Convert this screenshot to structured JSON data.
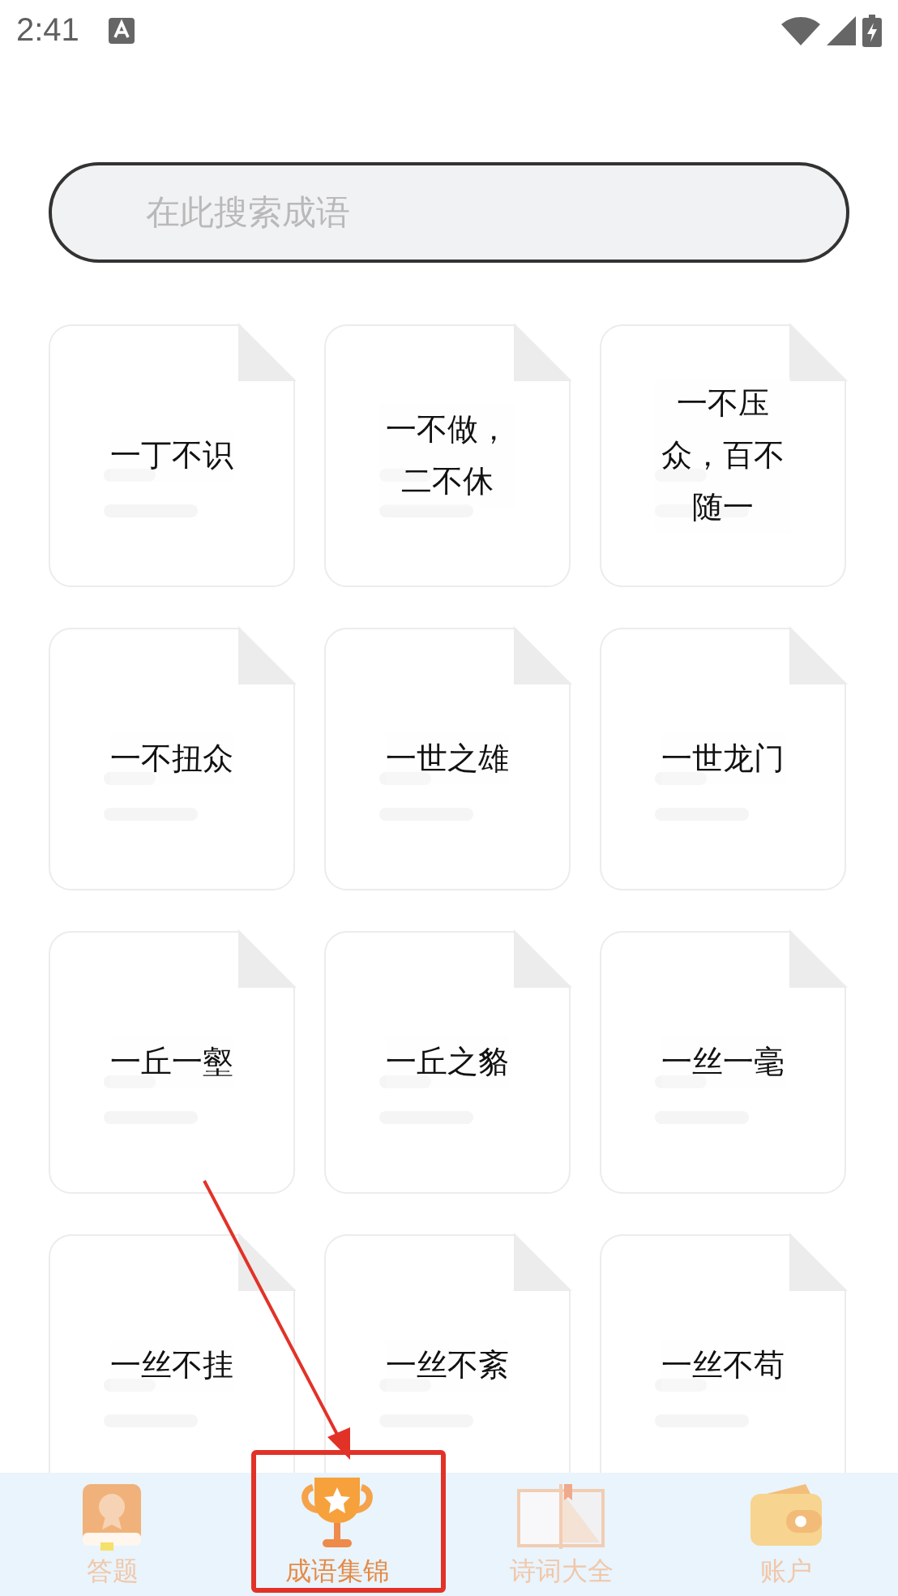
{
  "status_bar": {
    "time": "2:41"
  },
  "search": {
    "placeholder": "在此搜索成语"
  },
  "idioms": [
    {
      "text": "一丁不识"
    },
    {
      "text": "一不做，二不休"
    },
    {
      "text": "一不压众，百不随一"
    },
    {
      "text": "一不扭众"
    },
    {
      "text": "一世之雄"
    },
    {
      "text": "一世龙门"
    },
    {
      "text": "一丘一壑"
    },
    {
      "text": "一丘之貉"
    },
    {
      "text": "一丝一毫"
    },
    {
      "text": "一丝不挂"
    },
    {
      "text": "一丝不紊"
    },
    {
      "text": "一丝不苟"
    }
  ],
  "tabs": [
    {
      "label": "答题",
      "kind": "book",
      "selected": false
    },
    {
      "label": "成语集锦",
      "kind": "trophy",
      "selected": true
    },
    {
      "label": "诗词大全",
      "kind": "open-book",
      "selected": false
    },
    {
      "label": "账户",
      "kind": "wallet",
      "selected": false
    }
  ]
}
